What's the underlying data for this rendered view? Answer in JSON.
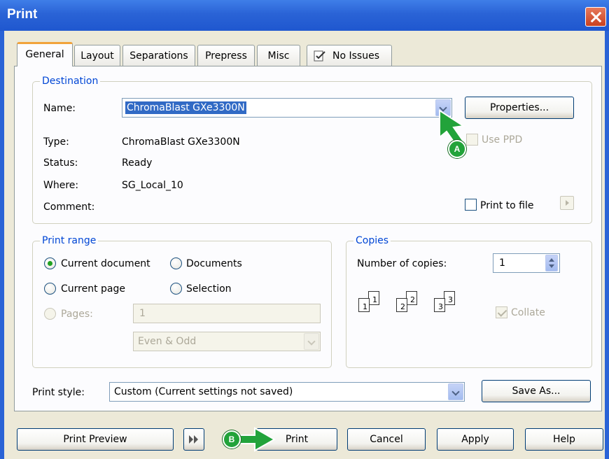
{
  "window": {
    "title": "Print"
  },
  "tabs": [
    "General",
    "Layout",
    "Separations",
    "Prepress",
    "Misc",
    "No Issues"
  ],
  "destination": {
    "group_title": "Destination",
    "name_label": "Name:",
    "name_value": "ChromaBlast GXe3300N",
    "properties_button": "Properties...",
    "use_ppd_label": "Use PPD",
    "type_label": "Type:",
    "type_value": "ChromaBlast GXe3300N",
    "status_label": "Status:",
    "status_value": "Ready",
    "where_label": "Where:",
    "where_value": "SG_Local_10",
    "comment_label": "Comment:",
    "print_to_file_label": "Print to file"
  },
  "print_range": {
    "group_title": "Print range",
    "current_document": "Current document",
    "documents": "Documents",
    "current_page": "Current page",
    "selection": "Selection",
    "pages": "Pages:",
    "pages_value": "1",
    "parity_value": "Even & Odd"
  },
  "copies": {
    "group_title": "Copies",
    "number_label": "Number of copies:",
    "number_value": "1",
    "collate_label": "Collate",
    "collate_pages": [
      {
        "back": "1",
        "front": "1"
      },
      {
        "back": "2",
        "front": "2"
      },
      {
        "back": "3",
        "front": "3"
      }
    ]
  },
  "print_style": {
    "label": "Print style:",
    "value": "Custom (Current settings not saved)",
    "save_as_button": "Save As..."
  },
  "footer": {
    "print_preview": "Print Preview",
    "print": "Print",
    "cancel": "Cancel",
    "apply": "Apply",
    "help": "Help"
  },
  "callouts": {
    "a": "A",
    "b": "B"
  },
  "colors": {
    "titlebar": "#2a63d6",
    "dialog_bg": "#ece9d8",
    "callout_green": "#22a33a",
    "group_title": "#0046d5"
  }
}
